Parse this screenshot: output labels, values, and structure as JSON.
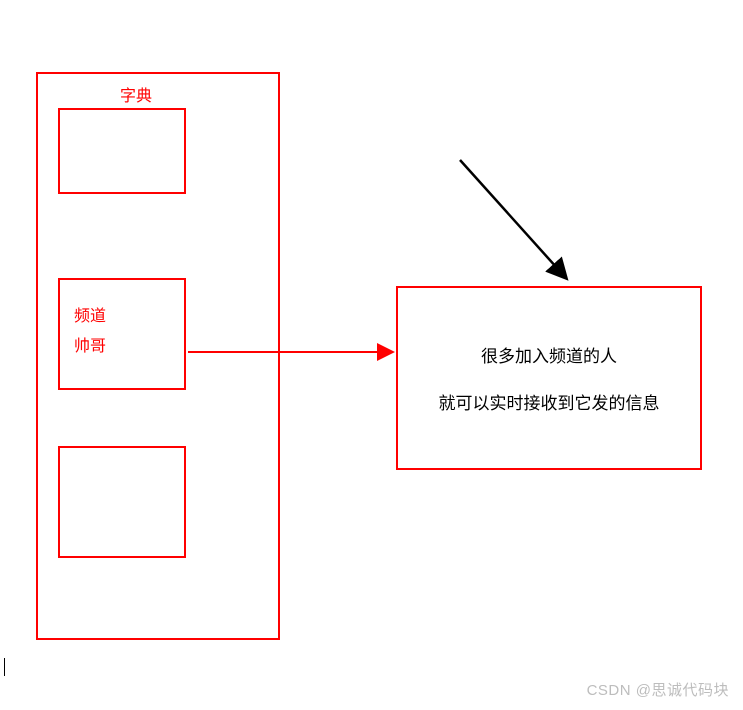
{
  "outer": {
    "title": "字典"
  },
  "middle_box": {
    "line1": "频道",
    "line2": "帅哥"
  },
  "right": {
    "line1": "很多加入频道的人",
    "line2": "就可以实时接收到它发的信息"
  },
  "watermark": "CSDN @思诚代码块",
  "colors": {
    "border": "#ff0000",
    "text_red": "#ff0000",
    "text_black": "#000000"
  },
  "icons": {
    "arrow_red": "arrow-right-red",
    "arrow_black": "arrow-diagonal-black"
  }
}
